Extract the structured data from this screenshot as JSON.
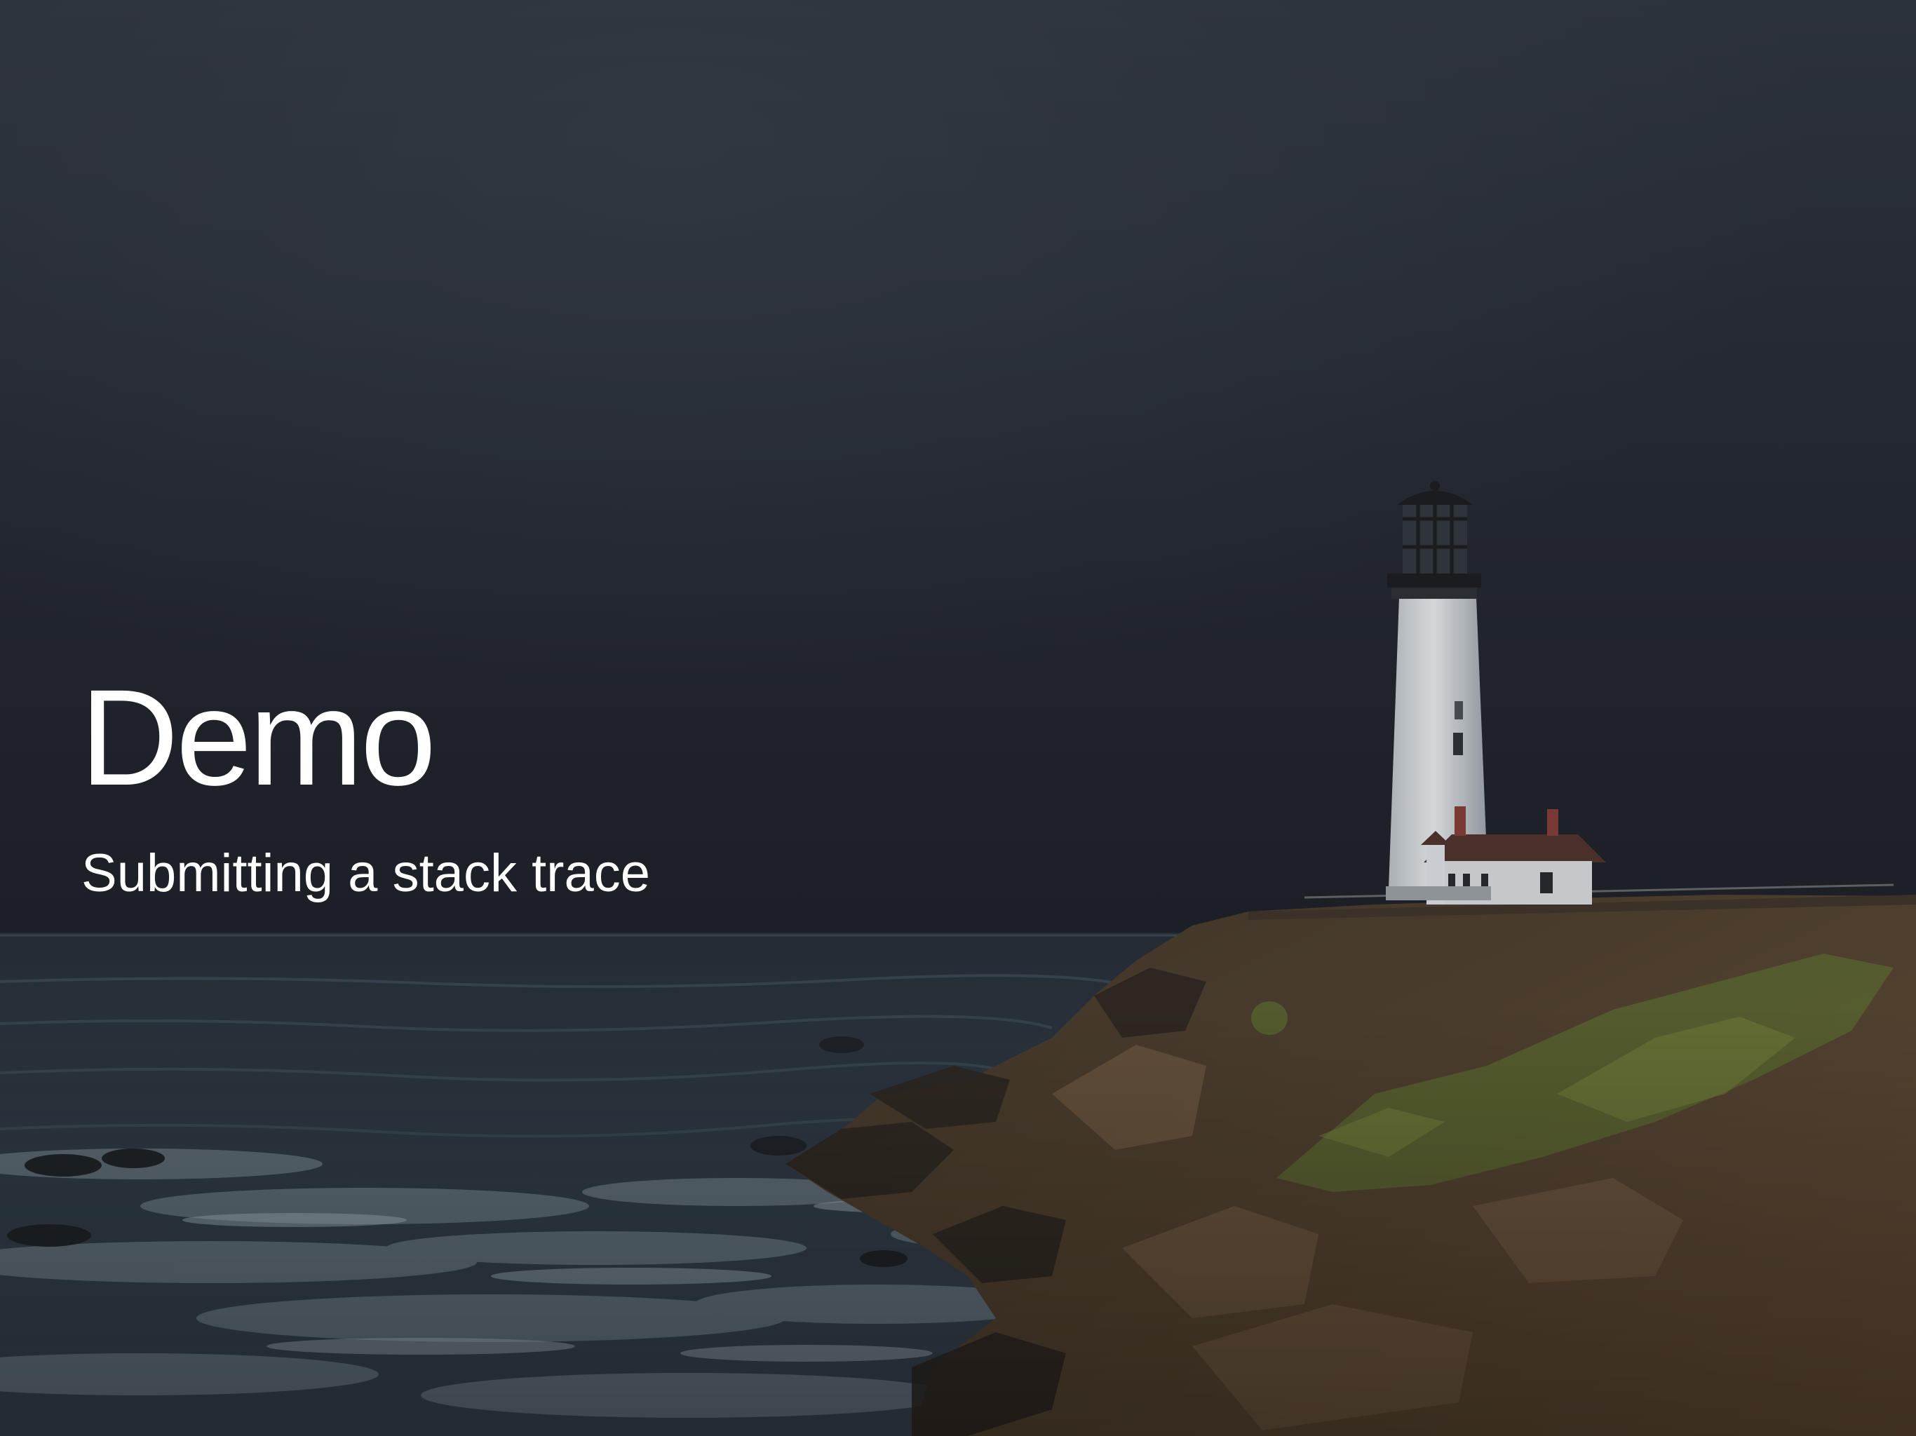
{
  "slide": {
    "title": "Demo",
    "subtitle": "Submitting a stack trace"
  },
  "background": {
    "subject": "lighthouse-on-cliff-at-dusk-photo",
    "colors": {
      "sky_top": "#2c323a",
      "sky_horizon": "#1d2127",
      "sea": "#2b3640",
      "surf": "#8a9aa3",
      "cliff": "#4a3b2c",
      "grass": "#55622f",
      "lighthouse": "#c9cdd1",
      "roof": "#5a3a34"
    }
  }
}
